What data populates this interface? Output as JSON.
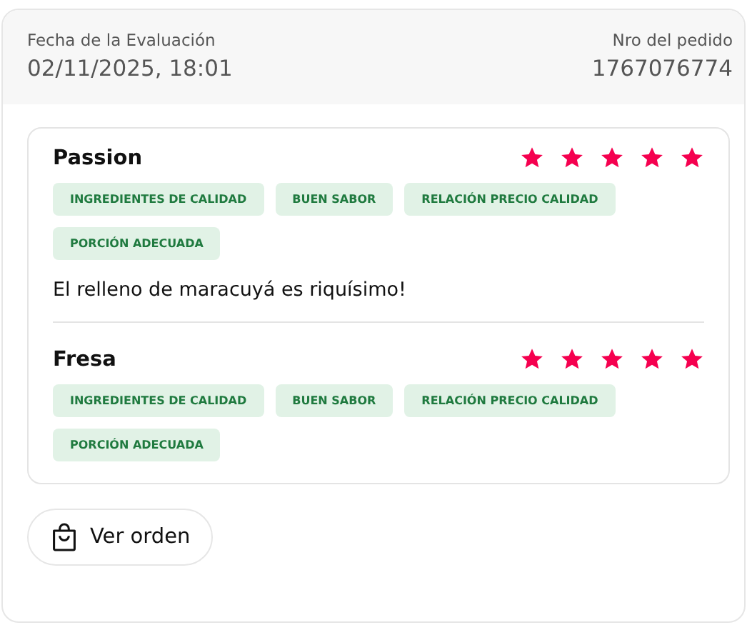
{
  "header": {
    "date_label": "Fecha de la Evaluación",
    "date": "02/11/2025, 18:01",
    "order_label": "Nro del pedido",
    "order_number": "1767076774"
  },
  "products": [
    {
      "name": "Passion",
      "stars": 5,
      "tags": [
        "INGREDIENTES DE CALIDAD",
        "BUEN SABOR",
        "RELACIÓN PRECIO CALIDAD",
        "PORCIÓN ADECUADA"
      ],
      "comment": "El relleno de maracuyá es riquísimo!"
    },
    {
      "name": "Fresa",
      "stars": 5,
      "tags": [
        "INGREDIENTES DE CALIDAD",
        "BUEN SABOR",
        "RELACIÓN PRECIO CALIDAD",
        "PORCIÓN ADECUADA"
      ]
    }
  ],
  "button": {
    "label": "Ver orden"
  }
}
